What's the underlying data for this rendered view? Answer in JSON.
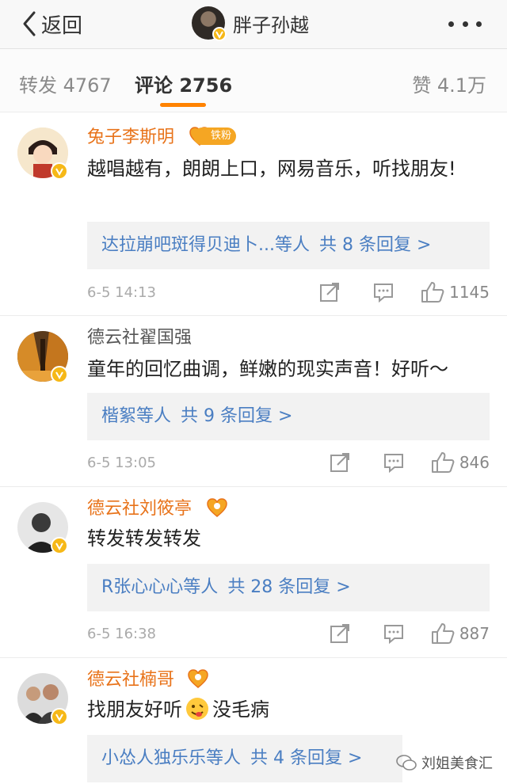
{
  "header": {
    "back_label": "返回",
    "title": "胖子孙越"
  },
  "tabs": {
    "repost": "转发 4767",
    "comment": "评论 2756",
    "like": "赞 4.1万"
  },
  "comments": [
    {
      "name": "兔子李斯明",
      "badge": "铁粉",
      "text": "越唱越有，朗朗上口，网易音乐，听找朋友!",
      "reply_who": "达拉崩吧斑得贝迪卜...",
      "reply_suffix": "等人",
      "reply_count": "共 8 条回复 >",
      "time": "6-5 14:13",
      "likes": "1145"
    },
    {
      "name": "德云社翟国强",
      "text": "童年的回忆曲调，鲜嫩的现实声音！好听～",
      "reply_who": "楷絮",
      "reply_suffix": "等人",
      "reply_count": "共 9 条回复 >",
      "time": "6-5 13:05",
      "likes": "846"
    },
    {
      "name": "德云社刘筱亭",
      "text": "转发转发转发",
      "reply_who": "R张心心心",
      "reply_suffix": "等人",
      "reply_count": "共 28 条回复 >",
      "time": "6-5 16:38",
      "likes": "887"
    },
    {
      "name": "德云社楠哥",
      "text_a": "找朋友好听",
      "text_b": "没毛病",
      "reply_who": "小怂人独乐乐",
      "reply_suffix": "等人",
      "reply_count": "共 4 条回复 >"
    }
  ],
  "watermark": "刘姐美食汇",
  "colors": {
    "name_orange": "#e8731a",
    "reply_blue": "#4a7ec2",
    "accent": "#ff8200",
    "verified": "#f6b817"
  }
}
